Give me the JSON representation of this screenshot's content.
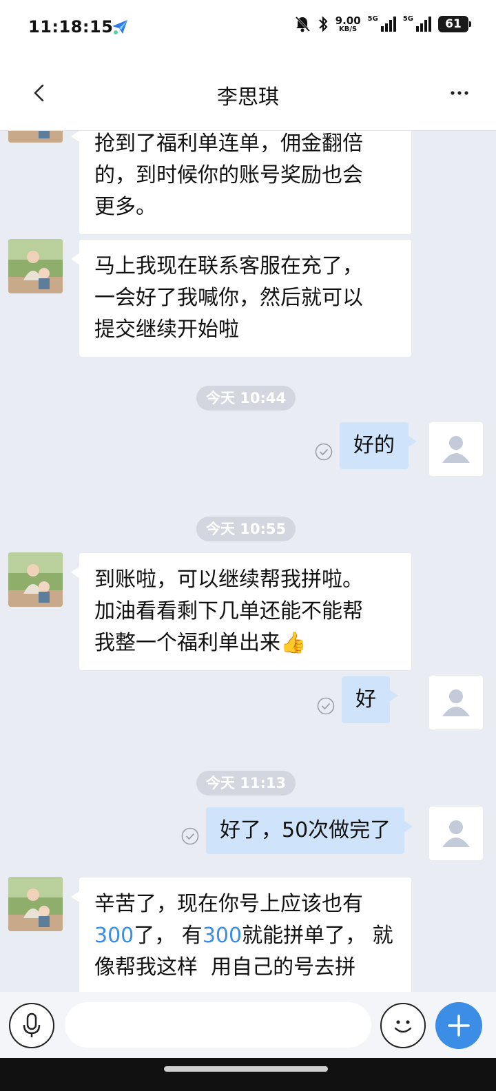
{
  "status_bar": {
    "time": "11:18:15",
    "speed_value": "9.00",
    "speed_unit": "KB/S",
    "network_1": "5G",
    "network_2": "5G",
    "battery": "61"
  },
  "header": {
    "title": "李思琪"
  },
  "messages": [
    {
      "lines": [
        "抢到了福利单连单，佣金翻倍",
        "的，到时候你的账号奖励也会",
        "更多。"
      ]
    },
    {
      "lines": [
        "马上我现在联系客服在充了，",
        "一会好了我喊你，然后就可以",
        "提交继续开始啦"
      ]
    },
    {
      "time": "今天 10:44"
    },
    {
      "text": "好的"
    },
    {
      "time": "今天 10:55"
    },
    {
      "lines": [
        "到账啦，可以继续帮我拼啦。",
        "加油看看剩下几单还能不能帮",
        "我整一个福利单出来👍"
      ]
    },
    {
      "text": "好"
    },
    {
      "time": "今天 11:13"
    },
    {
      "text": "好了，50次做完了"
    },
    {
      "line1": "辛苦了，现在你号上应该也有",
      "line2_num1": "300",
      "line2_mid": "了， 有",
      "line2_num2": "300",
      "line2_end": "就能拼单了， 就",
      "line3": "像帮我这样  用自己的号去拼"
    }
  ],
  "input": {
    "placeholder": ""
  },
  "colors": {
    "accent": "#3b8de6",
    "outgoing_bubble": "#cfe4fb",
    "chat_background": "#e9ecf3"
  }
}
